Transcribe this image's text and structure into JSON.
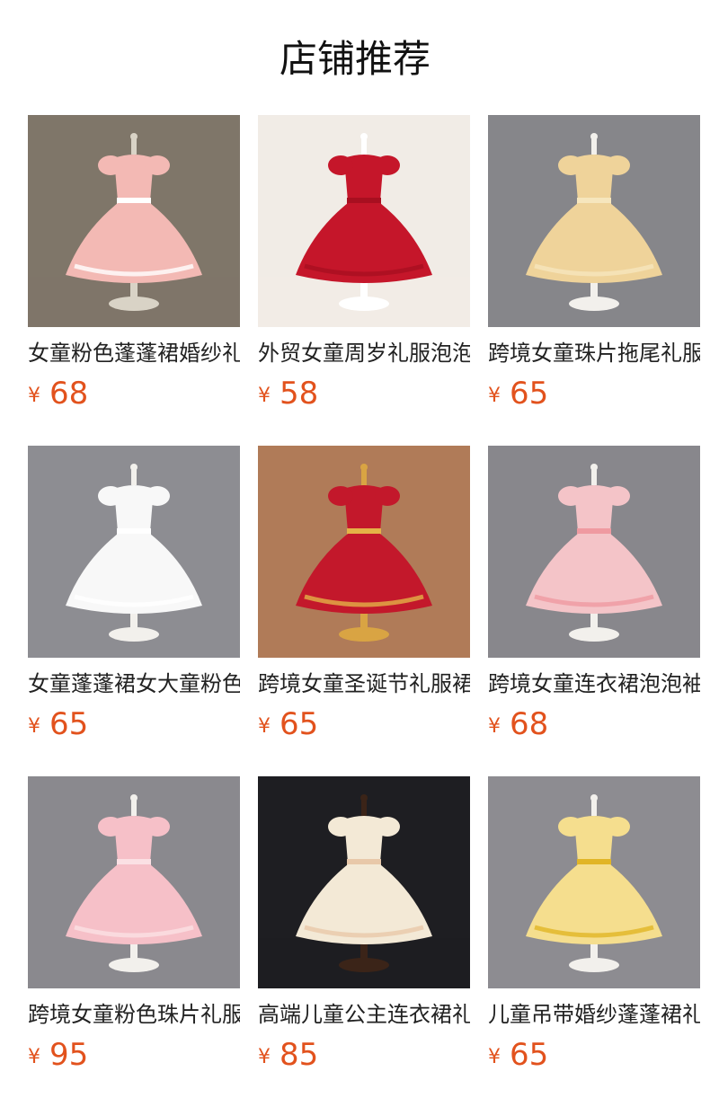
{
  "header": {
    "title": "店铺推荐"
  },
  "products": [
    {
      "name": "女童粉色蓬蓬裙婚纱礼服",
      "currency": "¥",
      "price": "68",
      "bg": "#7f7669",
      "dress": "#f3b9b4",
      "accent": "#ffffff",
      "stand": "#d9d3c6"
    },
    {
      "name": "外贸女童周岁礼服泡泡袖",
      "currency": "¥",
      "price": "58",
      "bg": "#f1ece6",
      "dress": "#c5162a",
      "accent": "#a80f20",
      "stand": "#ffffff"
    },
    {
      "name": "跨境女童珠片拖尾礼服",
      "currency": "¥",
      "price": "65",
      "bg": "#86868a",
      "dress": "#efd39a",
      "accent": "#f6e6bd",
      "stand": "#f2f0ec"
    },
    {
      "name": "女童蓬蓬裙女大童粉色",
      "currency": "¥",
      "price": "65",
      "bg": "#8d8d92",
      "dress": "#f8f8f8",
      "accent": "#ffffff",
      "stand": "#f2f0ec"
    },
    {
      "name": "跨境女童圣诞节礼服裙",
      "currency": "¥",
      "price": "65",
      "bg": "#b07b58",
      "dress": "#c3182b",
      "accent": "#e4b347",
      "stand": "#d9a443"
    },
    {
      "name": "跨境女童连衣裙泡泡袖",
      "currency": "¥",
      "price": "68",
      "bg": "#88878c",
      "dress": "#f4c4c8",
      "accent": "#ef9aa1",
      "stand": "#f2f0ec"
    },
    {
      "name": "跨境女童粉色珠片礼服",
      "currency": "¥",
      "price": "95",
      "bg": "#8a898e",
      "dress": "#f6c0c8",
      "accent": "#fbe0e4",
      "stand": "#f2f0ec"
    },
    {
      "name": "高端儿童公主连衣裙礼服",
      "currency": "¥",
      "price": "85",
      "bg": "#1e1e22",
      "dress": "#f3e9d6",
      "accent": "#e8c8a9",
      "stand": "#3b2418"
    },
    {
      "name": "儿童吊带婚纱蓬蓬裙礼服",
      "currency": "¥",
      "price": "65",
      "bg": "#8d8c91",
      "dress": "#f5de8e",
      "accent": "#e1b526",
      "stand": "#f2f0ec"
    }
  ]
}
